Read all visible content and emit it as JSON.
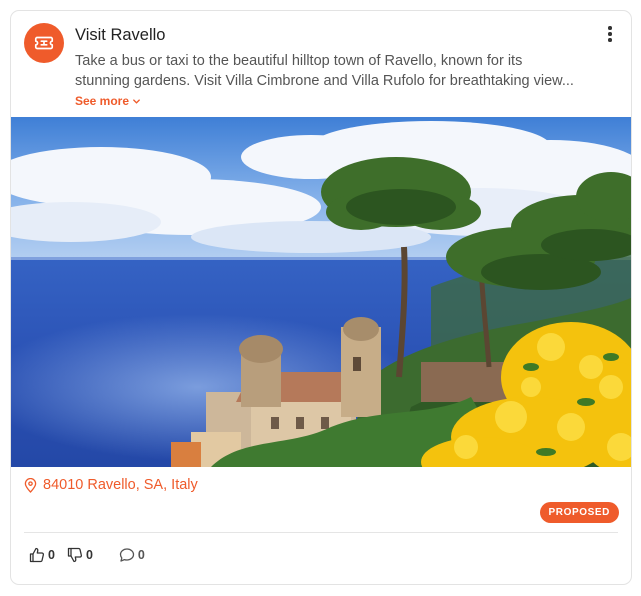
{
  "card": {
    "title": "Visit Ravello",
    "description_line1": "Take a bus or taxi to the beautiful hilltop town of Ravello, known for its",
    "description_line2": "stunning gardens. Visit Villa Cimbrone and Villa Rufolo for breathtaking view...",
    "see_more_label": "See more",
    "icon": "ticket-icon",
    "photo_alt": "Coastal view of Ravello with pine trees and yellow flowers",
    "location": "84010 Ravello, SA, Italy",
    "status_badge": "PROPOSED",
    "likes": "0",
    "dislikes": "0",
    "comments": "0"
  },
  "colors": {
    "accent": "#ef5b2b",
    "text": "#222222",
    "muted": "#555555",
    "border": "#e3e3e3"
  }
}
